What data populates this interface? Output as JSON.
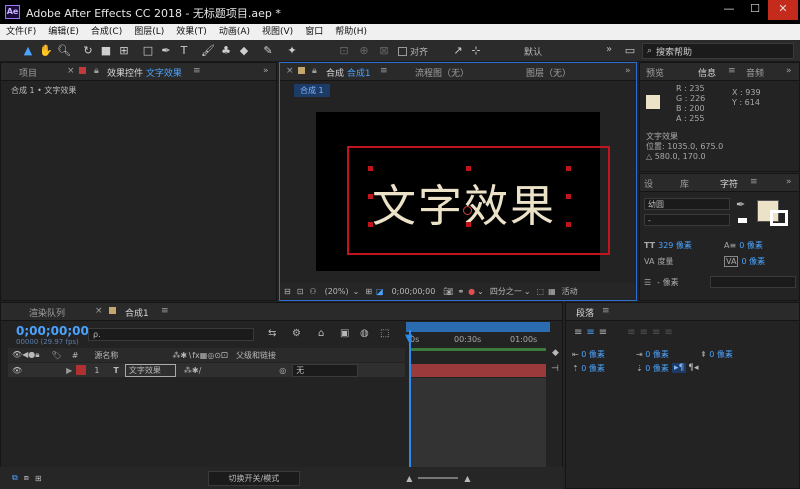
{
  "window": {
    "title": "Adobe After Effects CC 2018 - 无标题项目.aep *",
    "app_badge": "Ae",
    "minimize": "—",
    "maximize": "☐",
    "close": "✕"
  },
  "menu": [
    "文件(F)",
    "编辑(E)",
    "合成(C)",
    "图层(L)",
    "效果(T)",
    "动画(A)",
    "视图(V)",
    "窗口",
    "帮助(H)"
  ],
  "toolbar": {
    "snap_label": "对齐",
    "workspace": "默认",
    "search_placeholder": "搜索帮助",
    "more": "»"
  },
  "project_panel": {
    "tab_project": "项目",
    "tab_effects_prefix": "效果控件",
    "tab_effects_name": "文字效果",
    "breadcrumb": "合成 1 • 文字效果"
  },
  "comp_panel": {
    "tab_comp_prefix": "合成",
    "tab_comp_name": "合成1",
    "tab_flowchart": "流程图（无）",
    "tab_layer": "图层（无）",
    "subtab": "合成 1",
    "canvas_text": "文字效果"
  },
  "viewer_footer": {
    "zoom": "(20%)",
    "timecode": "0;00;00;00",
    "resolution": "四分之一",
    "active_camera": "活动"
  },
  "info_panel": {
    "tab_preview": "预览",
    "tab_info": "信息",
    "tab_audio": "音频",
    "r": "R : 235",
    "g": "G : 226",
    "b": "B : 200",
    "a": "A : 255",
    "x": "X : 939",
    "y": "Y : 614",
    "layer_name": "文字效果",
    "position": "位置: 1035.0, 675.0",
    "delta": "△ 580.0, 170.0",
    "fill_color": "#ebe2c8"
  },
  "character_panel": {
    "tab_paragraph_a": "设",
    "tab_library": "库",
    "tab_character": "字符",
    "font": "幼圆",
    "style": "-",
    "size": "329 像素",
    "leading": "0 像素",
    "tracking_label": "度量",
    "kerning": "0 像素",
    "stroke_width": "- 像素"
  },
  "timeline": {
    "tab_render": "渲染队列",
    "tab_comp_name": "合成1",
    "timecode": "0;00;00;00",
    "fps": "00000 (29.97 fps)",
    "search_placeholder": "ρ.",
    "col_number": "#",
    "col_source": "源名称",
    "col_parent": "父级和链接",
    "layer_index": "1",
    "layer_type": "T",
    "layer_name": "文字效果",
    "layer_parent": "无",
    "ruler": [
      "0s",
      "00:30s",
      "01:00s"
    ],
    "footer_toggle": "切换开关/模式"
  },
  "paragraph_panel": {
    "tab": "段落",
    "indent_left": "0 像素",
    "indent_right": "0 像素",
    "indent_first": "0 像素",
    "space_before": "0 像素",
    "space_after": "0 像素"
  }
}
